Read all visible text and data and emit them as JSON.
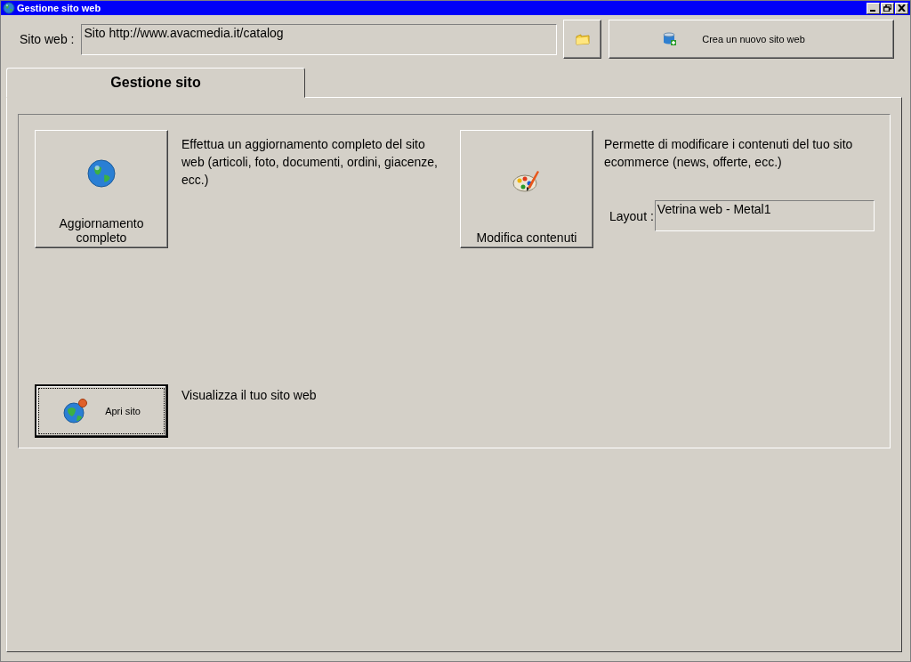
{
  "window": {
    "title": "Gestione sito web"
  },
  "site": {
    "label": "Sito web :",
    "value": "Sito http://www.avacmedia.it/catalog"
  },
  "new_site_button": {
    "label": "Crea un nuovo sito web"
  },
  "tabs": [
    {
      "label": "Gestione sito",
      "selected": true
    }
  ],
  "actions": [
    {
      "kind": "update",
      "label": "Aggiornamento completo",
      "description": "Effettua un aggiornamento completo del sito web (articoli, foto, documenti, ordini, giacenze, ecc.)",
      "focused": false
    },
    {
      "kind": "edit",
      "label": "Modifica contenuti",
      "description": "Permette di modificare i contenuti del tuo sito ecommerce (news, offerte, ecc.)",
      "focused": false
    },
    {
      "kind": "open",
      "label": "Apri sito",
      "description": "Visualizza il tuo sito web",
      "focused": true
    }
  ],
  "layout": {
    "label": "Layout :",
    "value": "Vetrina web - Metal1"
  }
}
